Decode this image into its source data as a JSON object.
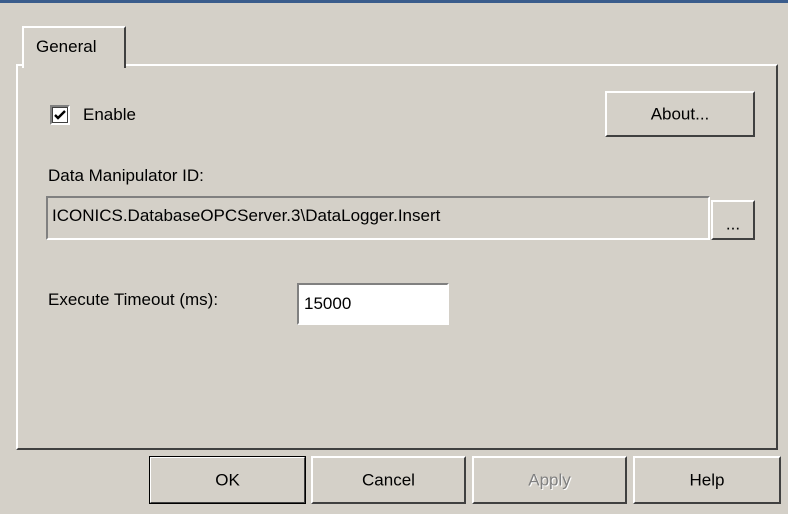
{
  "tabs": [
    {
      "label": "General"
    }
  ],
  "general": {
    "enable_label": "Enable",
    "enable_checked": true,
    "about_button": "About...",
    "data_manipulator_label": "Data Manipulator ID:",
    "data_manipulator_value": "ICONICS.DatabaseOPCServer.3\\DataLogger.Insert",
    "browse_button": "...",
    "timeout_label": "Execute Timeout (ms):",
    "timeout_value": "15000"
  },
  "footer": {
    "ok": "OK",
    "cancel": "Cancel",
    "apply": "Apply",
    "help": "Help"
  },
  "colors": {
    "face": "#d4d0c8",
    "highlight": "#ffffff",
    "shadow": "#808080",
    "dark_shadow": "#404040",
    "top_bar": "#3a5c8c"
  },
  "icons": {
    "checkbox": "check-mark-icon"
  }
}
